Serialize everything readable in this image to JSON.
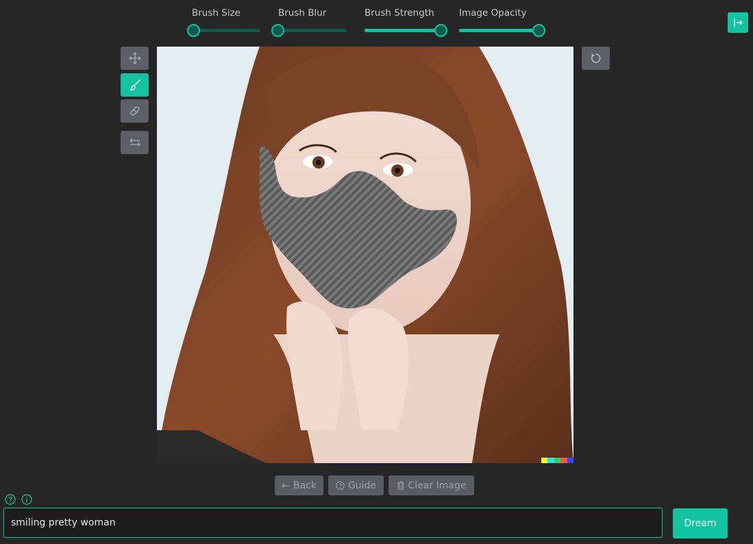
{
  "sliders": [
    {
      "id": "brush-size",
      "label": "Brush Size",
      "value": 0.0
    },
    {
      "id": "brush-blur",
      "label": "Brush Blur",
      "value": 0.0
    },
    {
      "id": "brush-strength",
      "label": "Brush Strength",
      "value": 0.92
    },
    {
      "id": "image-opacity",
      "label": "Image Opacity",
      "value": 0.92
    }
  ],
  "toolbar": {
    "move": "move-arrows-icon",
    "brush": "brush-icon",
    "eraser": "eraser-icon",
    "swap": "swap-arrows-icon",
    "active": "brush"
  },
  "canvas": {
    "palette_colors": [
      "#ffff33",
      "#33e0e0",
      "#33cc66",
      "#ff5a33",
      "#3344ff"
    ]
  },
  "buttons": {
    "back": "Back",
    "guide": "Guide",
    "clear": "Clear Image",
    "dream": "Dream"
  },
  "prompt": {
    "value": "smiling pretty woman"
  },
  "colors": {
    "accent": "#14c4a0",
    "background": "#262626",
    "button": "#5c5f66"
  }
}
